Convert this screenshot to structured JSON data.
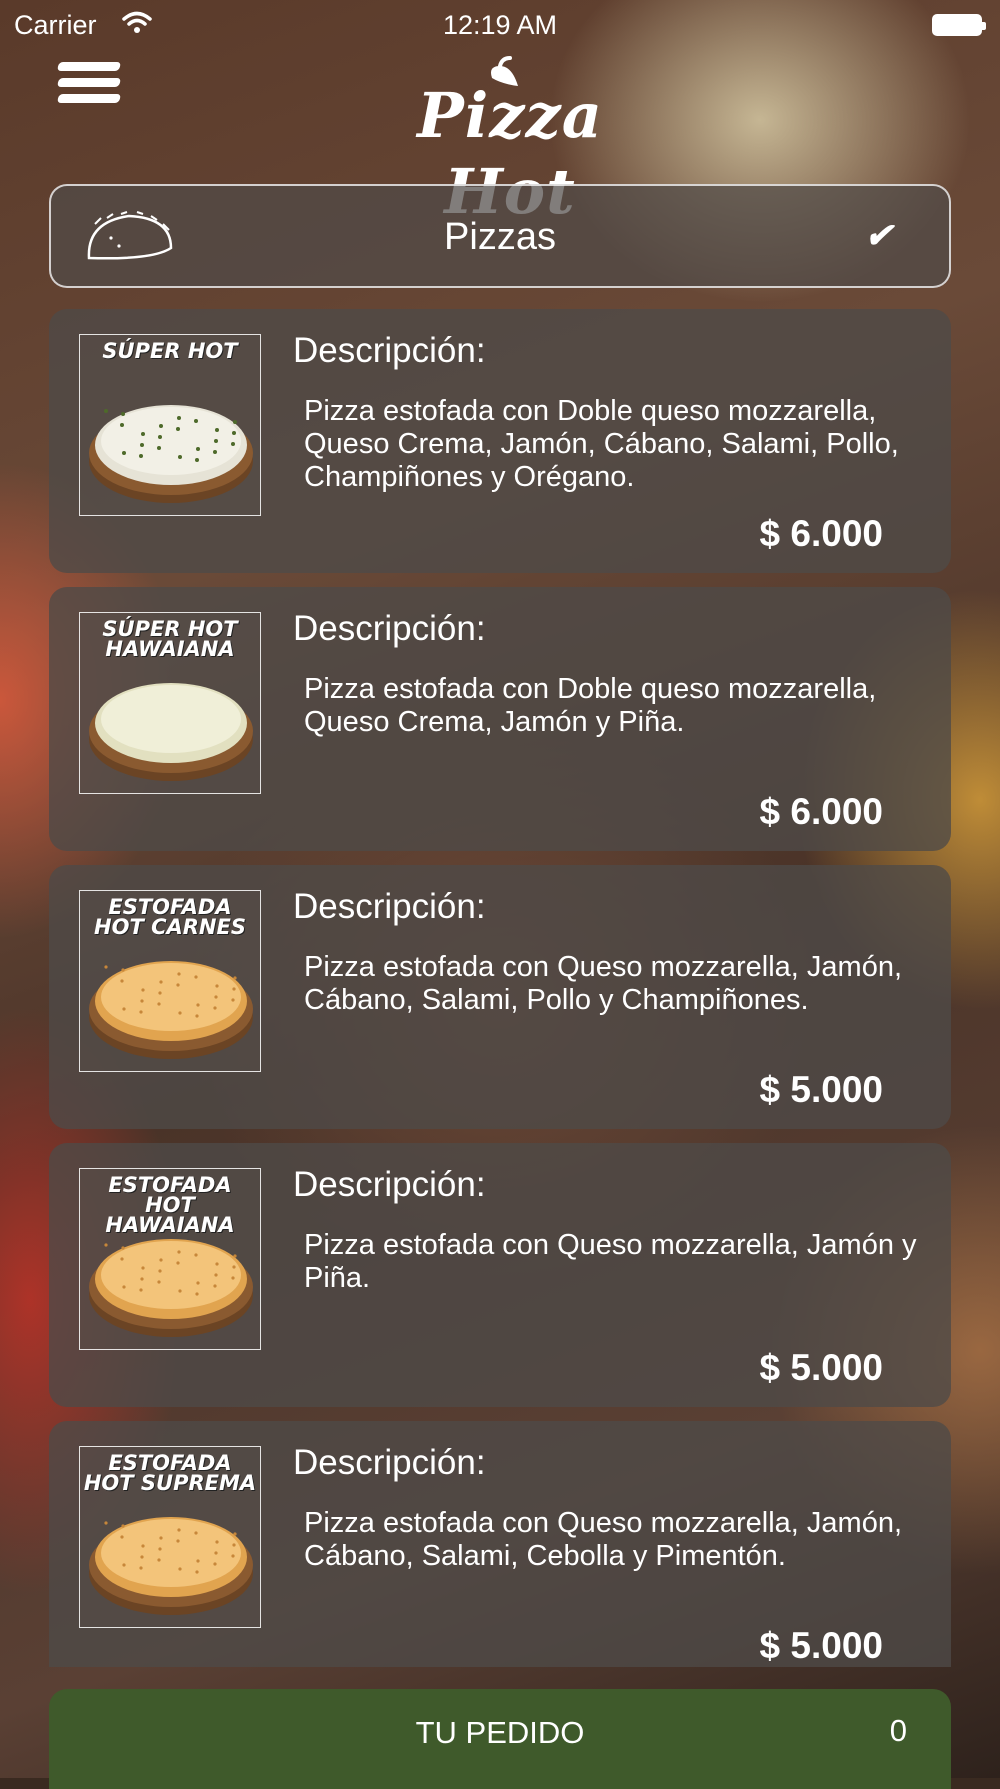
{
  "status_bar": {
    "carrier": "Carrier",
    "time": "12:19 AM",
    "wifi_icon": "wifi-icon",
    "battery_icon": "battery-icon"
  },
  "header": {
    "logo_text": "Pizza Hot",
    "menu_icon": "hamburger-menu-icon"
  },
  "category_selector": {
    "label": "Pizzas",
    "icon": "empanada-icon",
    "chevron": "✔"
  },
  "products": [
    {
      "image_label": "Súper Hot",
      "heading": "Descripción:",
      "description": "Pizza estofada con Doble queso mozzarella, Queso Crema, Jamón, Cábano, Salami, Pollo, Champiñones y Orégano.",
      "price": "$ 6.000",
      "style": "herb"
    },
    {
      "image_label": "Súper Hot Hawaiana",
      "heading": "Descripción:",
      "description": "Pizza estofada con Doble queso mozzarella, Queso Crema, Jamón y Piña.",
      "price": "$ 6.000",
      "style": "white"
    },
    {
      "image_label": "Estofada Hot Carnes",
      "heading": "Descripción:",
      "description": "Pizza estofada con Queso mozzarella, Jamón, Cábano, Salami, Pollo y Champiñones.",
      "price": "$ 5.000",
      "style": "golden"
    },
    {
      "image_label": "Estofada Hot Hawaiana",
      "heading": "Descripción:",
      "description": "Pizza estofada con Queso mozzarella, Jamón y Piña.",
      "price": "$ 5.000",
      "style": "golden"
    },
    {
      "image_label": "Estofada Hot Suprema",
      "heading": "Descripción:",
      "description": "Pizza estofada con Queso mozzarella, Jamón, Cábano, Salami, Cebolla y Pimentón.",
      "price": "$ 5.000",
      "style": "golden"
    }
  ],
  "order_bar": {
    "label": "TU PEDIDO",
    "count": "0",
    "color": "#3f5a2b"
  }
}
